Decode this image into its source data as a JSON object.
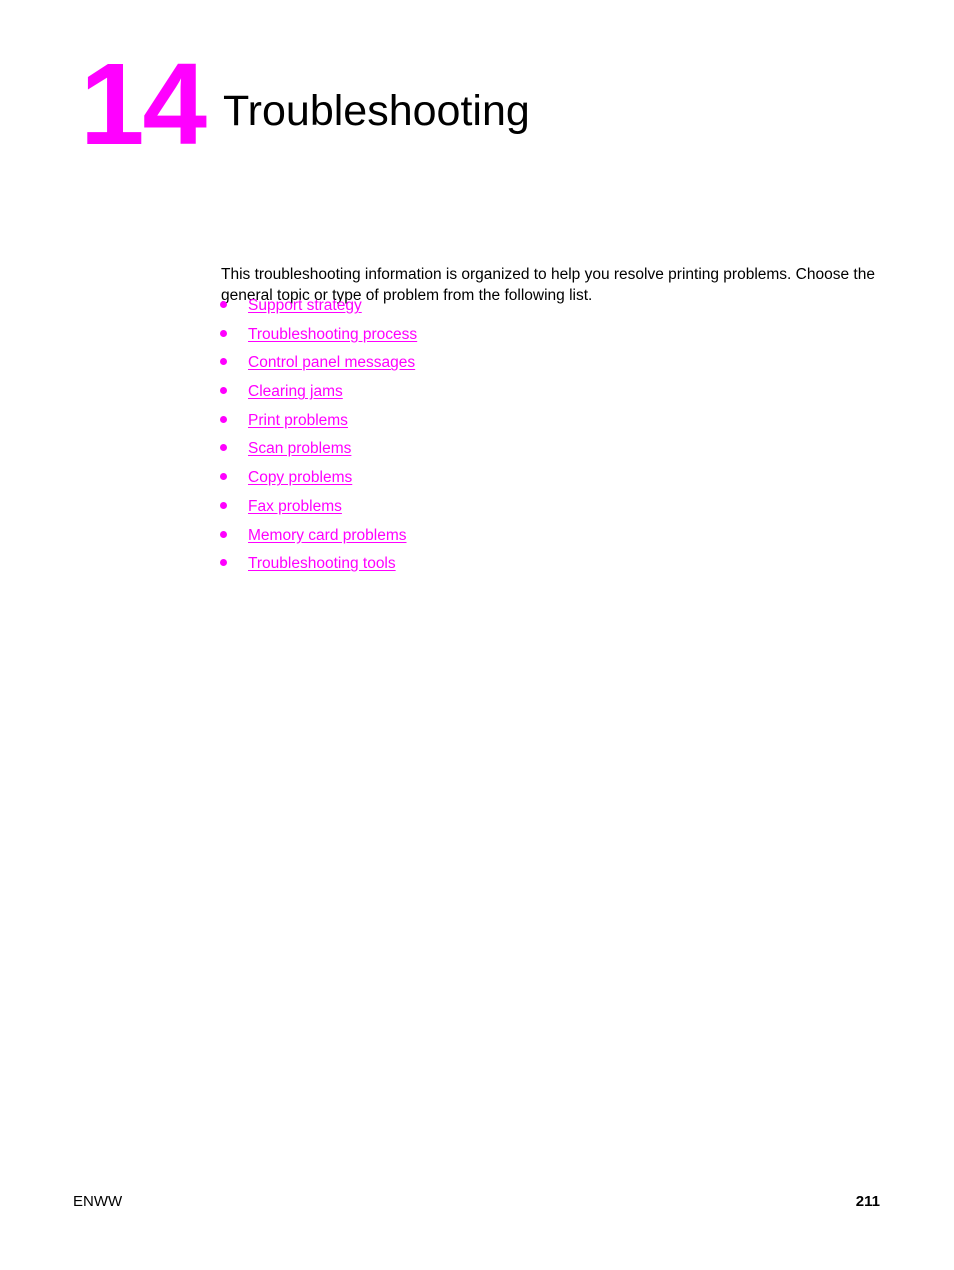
{
  "document": {
    "chapter_number": "14",
    "chapter_title": "Troubleshooting",
    "intro_paragraph": "This troubleshooting information is organized to help you resolve printing problems. Choose the general topic or type of problem from the following list.",
    "accent_color": "#ff00ff",
    "text_color": "#000000",
    "background_color": "#ffffff"
  },
  "links": [
    {
      "label": "Support strategy"
    },
    {
      "label": "Troubleshooting process"
    },
    {
      "label": "Control panel messages"
    },
    {
      "label": "Clearing jams"
    },
    {
      "label": "Print problems"
    },
    {
      "label": "Scan problems"
    },
    {
      "label": "Copy problems"
    },
    {
      "label": "Fax problems"
    },
    {
      "label": "Memory card problems"
    },
    {
      "label": "Troubleshooting tools"
    }
  ],
  "footer": {
    "locale": "ENWW",
    "page_number": "211"
  }
}
